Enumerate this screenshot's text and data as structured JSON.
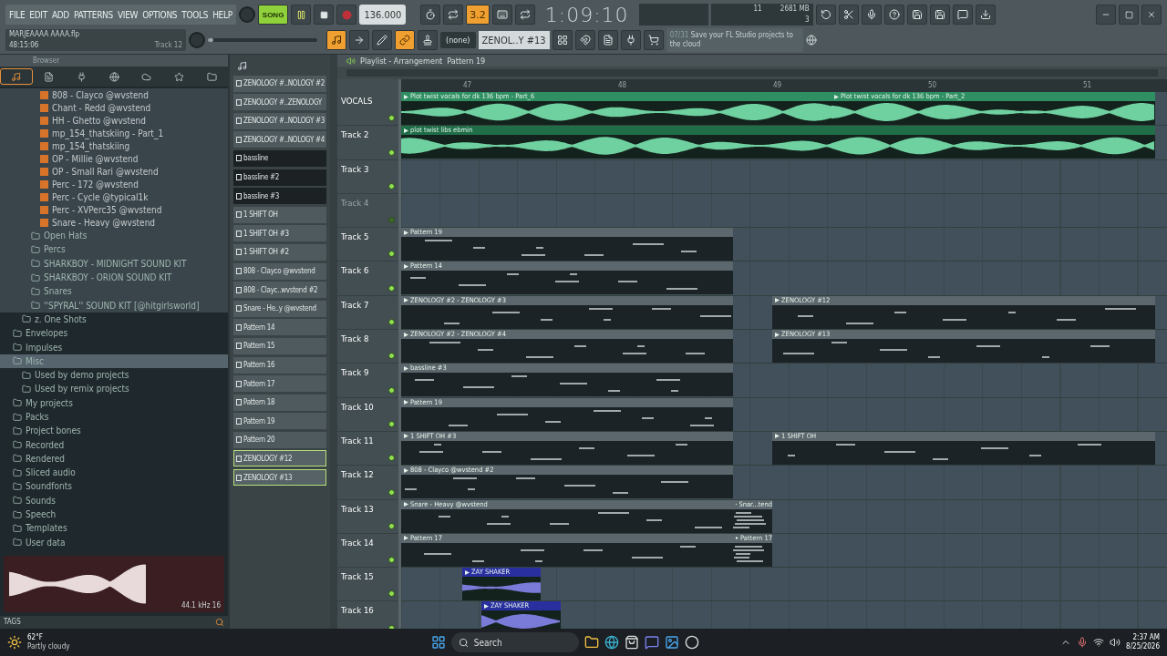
{
  "menu": [
    "FILE",
    "EDIT",
    "ADD",
    "PATTERNS",
    "VIEW",
    "OPTIONS",
    "TOOLS",
    "HELP"
  ],
  "hint_panel": {
    "file": "MARJEAAAA AAAA.flp",
    "time": "48:15:06",
    "track": "Track 12"
  },
  "transport": {
    "mode": "SONG",
    "playing": true,
    "recording": false,
    "tempo": "136.000",
    "time": "1:09:10"
  },
  "toolbar_top": [
    {
      "on": false
    },
    {
      "on": false
    },
    {
      "label": "3.2",
      "on": true
    },
    {
      "on": false
    },
    {
      "on": false
    }
  ],
  "toolbar_bottom": [
    {
      "on": true
    },
    {
      "on": false
    },
    {
      "on": false
    },
    {
      "on": true
    },
    {
      "on": false
    }
  ],
  "cpu": {
    "polyphony": "11",
    "memory": "2681 MB",
    "voices": "3"
  },
  "pattern_selector": {
    "preset": "(none)",
    "pattern": "ZENOL..Y #13"
  },
  "news": {
    "date": "07/31",
    "text": "Save your FL Studio projects to the cloud"
  },
  "master_pitch": {
    "level": 0.05
  },
  "browser": {
    "title": "Browser",
    "tabs": [
      {
        "selected": true
      },
      {
        "selected": false
      },
      {
        "selected": false
      },
      {
        "selected": false
      },
      {
        "selected": false
      },
      {
        "selected": false
      },
      {
        "selected": false
      }
    ],
    "tree": [
      {
        "children": [
          {
            "children": [
              {
                "children": [
                  {
                    "label": "808 - Clayco @wvstend",
                    "kind": "file",
                    "selected": false
                  },
                  {
                    "label": "Chant - Redd @wvstend",
                    "kind": "file",
                    "selected": false
                  },
                  {
                    "label": "HH - Ghetto @wvstend",
                    "kind": "file",
                    "selected": false
                  },
                  {
                    "label": "mp_154_thatskiing - Part_1",
                    "kind": "file",
                    "selected": false
                  },
                  {
                    "label": "mp_154_thatskiing",
                    "kind": "file",
                    "selected": false
                  },
                  {
                    "label": "OP - Millie @wvstend",
                    "kind": "file",
                    "selected": false
                  },
                  {
                    "label": "OP - Small Rari @wvstend",
                    "kind": "file",
                    "selected": false
                  },
                  {
                    "label": "Perc - 172 @wvstend",
                    "kind": "file",
                    "selected": false
                  },
                  {
                    "label": "Perc - Cycle @typical1k",
                    "kind": "file",
                    "selected": false
                  },
                  {
                    "label": "Perc - XVPerc35 @wvstend",
                    "kind": "file",
                    "selected": false
                  },
                  {
                    "label": "Snare - Heavy @wvstend",
                    "kind": "file",
                    "selected": false
                  }
                ]
              },
              {
                "label": "Open Hats",
                "kind": "folder",
                "selected": false
              },
              {
                "label": "Percs",
                "kind": "folder",
                "selected": false
              },
              {
                "label": "SHARKBOY - MIDNIGHT SOUND KIT",
                "kind": "folder",
                "selected": false
              },
              {
                "label": "SHARKBOY - ORION SOUND KIT",
                "kind": "folder",
                "selected": false
              },
              {
                "label": "Snares",
                "kind": "folder",
                "selected": false
              },
              {
                "label": "''SPYRAL'' SOUND KIT [@hitgirlsworld]",
                "kind": "folder",
                "selected": false
              }
            ]
          },
          {
            "label": "z. One Shots",
            "kind": "folder",
            "selected": false
          }
        ]
      },
      {
        "label": "Envelopes",
        "kind": "folder",
        "selected": false
      },
      {
        "label": "Impulses",
        "kind": "folder",
        "selected": false
      },
      {
        "label": "Misc",
        "kind": "folder",
        "selected": true,
        "children": [
          {
            "label": "Used by demo projects",
            "kind": "folder",
            "selected": false
          },
          {
            "label": "Used by remix projects",
            "kind": "folder",
            "selected": false
          }
        ]
      },
      {
        "label": "My projects",
        "kind": "folder",
        "selected": false
      },
      {
        "label": "Packs",
        "kind": "folder",
        "selected": false
      },
      {
        "label": "Project bones",
        "kind": "folder",
        "selected": false
      },
      {
        "label": "Recorded",
        "kind": "folder",
        "selected": false
      },
      {
        "label": "Rendered",
        "kind": "folder",
        "selected": false
      },
      {
        "label": "Sliced audio",
        "kind": "folder",
        "selected": false
      },
      {
        "label": "Soundfonts",
        "kind": "folder",
        "selected": false
      },
      {
        "label": "Sounds",
        "kind": "folder",
        "selected": false
      },
      {
        "label": "Speech",
        "kind": "folder",
        "selected": false
      },
      {
        "label": "Templates",
        "kind": "folder",
        "selected": false
      },
      {
        "label": "User data",
        "kind": "folder",
        "selected": false
      }
    ],
    "preview": {
      "rate": "44.1 kHz",
      "bits": "16"
    },
    "tags": "TAGS"
  },
  "pattern_list": [
    {
      "label": "ZENOLOGY #..NOLOGY #2",
      "kind": "plain",
      "selected": false
    },
    {
      "label": "ZENOLOGY #..ZENOLOGY",
      "kind": "plain",
      "selected": false
    },
    {
      "label": "ZENOLOGY #..NOLOGY #3",
      "kind": "plain",
      "selected": false
    },
    {
      "label": "ZENOLOGY #..NOLOGY #4",
      "kind": "plain",
      "selected": false
    },
    {
      "label": "bassline",
      "kind": "dark",
      "selected": false
    },
    {
      "label": "bassline #2",
      "kind": "dark",
      "selected": false
    },
    {
      "label": "bassline #3",
      "kind": "dark",
      "selected": false
    },
    {
      "label": "1 SHIFT OH",
      "kind": "plain",
      "selected": false
    },
    {
      "label": "1 SHIFT OH #3",
      "kind": "plain",
      "selected": false
    },
    {
      "label": "1 SHIFT OH #2",
      "kind": "plain",
      "selected": false
    },
    {
      "label": "808 - Clayco @wvstend",
      "kind": "plain",
      "selected": false
    },
    {
      "label": "808 - Clayc..wvstend #2",
      "kind": "plain",
      "selected": false
    },
    {
      "label": "Snare - He..y @wvstend",
      "kind": "plain",
      "selected": false
    },
    {
      "label": "Pattern 14",
      "kind": "plain",
      "selected": false
    },
    {
      "label": "Pattern 15",
      "kind": "plain",
      "selected": false
    },
    {
      "label": "Pattern 16",
      "kind": "plain",
      "selected": false
    },
    {
      "label": "Pattern 17",
      "kind": "plain",
      "selected": false
    },
    {
      "label": "Pattern 18",
      "kind": "plain",
      "selected": false
    },
    {
      "label": "Pattern 19",
      "kind": "plain",
      "selected": false
    },
    {
      "label": "Pattern 20",
      "kind": "plain",
      "selected": false
    },
    {
      "label": "ZENOLOGY #12",
      "kind": "plain",
      "selected": true
    },
    {
      "label": "ZENOLOGY #13",
      "kind": "plain",
      "selected": true
    }
  ],
  "playlist": {
    "title": "Playlist - Arrangement",
    "pattern": "Pattern 19",
    "bars": [
      "47",
      "48",
      "49",
      "50",
      "51"
    ],
    "tracks": [
      {
        "name": "VOCALS",
        "muted": false,
        "clips": [
          {
            "label": "Plot twist vocals for dk 136 bpm - Part_6",
            "kind": "audio",
            "color": "#2f8f62"
          },
          {
            "label": "Plot twist vocals for dk 136 bpm - Part_2",
            "kind": "audio",
            "color": "#2f8f62"
          }
        ]
      },
      {
        "name": "Track 2",
        "muted": false,
        "clips": [
          {
            "label": "plot twist libs ebmin",
            "kind": "audio",
            "color": "#1f6e48"
          }
        ]
      },
      {
        "name": "Track 3",
        "muted": false
      },
      {
        "name": "Track 4",
        "muted": true
      },
      {
        "name": "Track 5",
        "muted": false,
        "clips": [
          {
            "label": "Pattern 19",
            "kind": "pattern",
            "color": "#5b676d"
          }
        ]
      },
      {
        "name": "Track 6",
        "muted": false,
        "clips": [
          {
            "label": "Pattern 14",
            "kind": "pattern",
            "color": "#5b676d"
          }
        ]
      },
      {
        "name": "Track 7",
        "muted": false,
        "clips": [
          {
            "label": "ZENOLOGY #2 - ZENOLOGY #3",
            "kind": "pattern",
            "color": "#5b676d"
          },
          {
            "label": "ZENOLOGY #12",
            "kind": "pattern",
            "color": "#5b676d"
          }
        ]
      },
      {
        "name": "Track 8",
        "muted": false,
        "clips": [
          {
            "label": "ZENOLOGY #2 - ZENOLOGY #4",
            "kind": "pattern",
            "color": "#5b676d"
          },
          {
            "label": "ZENOLOGY #13",
            "kind": "pattern",
            "color": "#5b676d"
          }
        ]
      },
      {
        "name": "Track 9",
        "muted": false,
        "clips": [
          {
            "label": "bassline #3",
            "kind": "pattern",
            "color": "#5b676d"
          }
        ]
      },
      {
        "name": "Track 10",
        "muted": false,
        "clips": [
          {
            "label": "Pattern 19",
            "kind": "pattern",
            "color": "#5b676d"
          }
        ]
      },
      {
        "name": "Track 11",
        "muted": false,
        "clips": [
          {
            "label": "1 SHIFT OH #3",
            "kind": "pattern",
            "color": "#5b676d"
          },
          {
            "label": "1 SHIFT OH",
            "kind": "pattern",
            "color": "#5b676d"
          }
        ]
      },
      {
        "name": "Track 12",
        "muted": false,
        "clips": [
          {
            "label": "808 - Clayco @wvstend #2",
            "kind": "pattern",
            "color": "#5b676d"
          }
        ]
      },
      {
        "name": "Track 13",
        "muted": false,
        "clips": [
          {
            "label": "Snare - Heavy @wvstend",
            "kind": "pattern",
            "color": "#5b676d"
          },
          {
            "label": "Snar...tend",
            "kind": "pattern",
            "color": "#5b676d"
          }
        ]
      },
      {
        "name": "Track 14",
        "muted": false,
        "clips": [
          {
            "label": "Pattern 17",
            "kind": "pattern",
            "color": "#5b676d"
          },
          {
            "label": "Pattern 17",
            "kind": "pattern",
            "color": "#5b676d"
          }
        ]
      },
      {
        "name": "Track 15",
        "muted": false,
        "clips": [
          {
            "label": "ZAY SHAKER",
            "kind": "audio",
            "color": "#2a2fa0"
          }
        ]
      },
      {
        "name": "Track 16",
        "muted": false,
        "clips": [
          {
            "label": "ZAY SHAKER",
            "kind": "audio",
            "color": "#2a2fa0"
          }
        ]
      }
    ]
  },
  "taskbar": {
    "temperature": "62°F",
    "weather": "Partly cloudy",
    "search": "Search",
    "time": "2:37 AM",
    "date": "8/25/2026"
  }
}
